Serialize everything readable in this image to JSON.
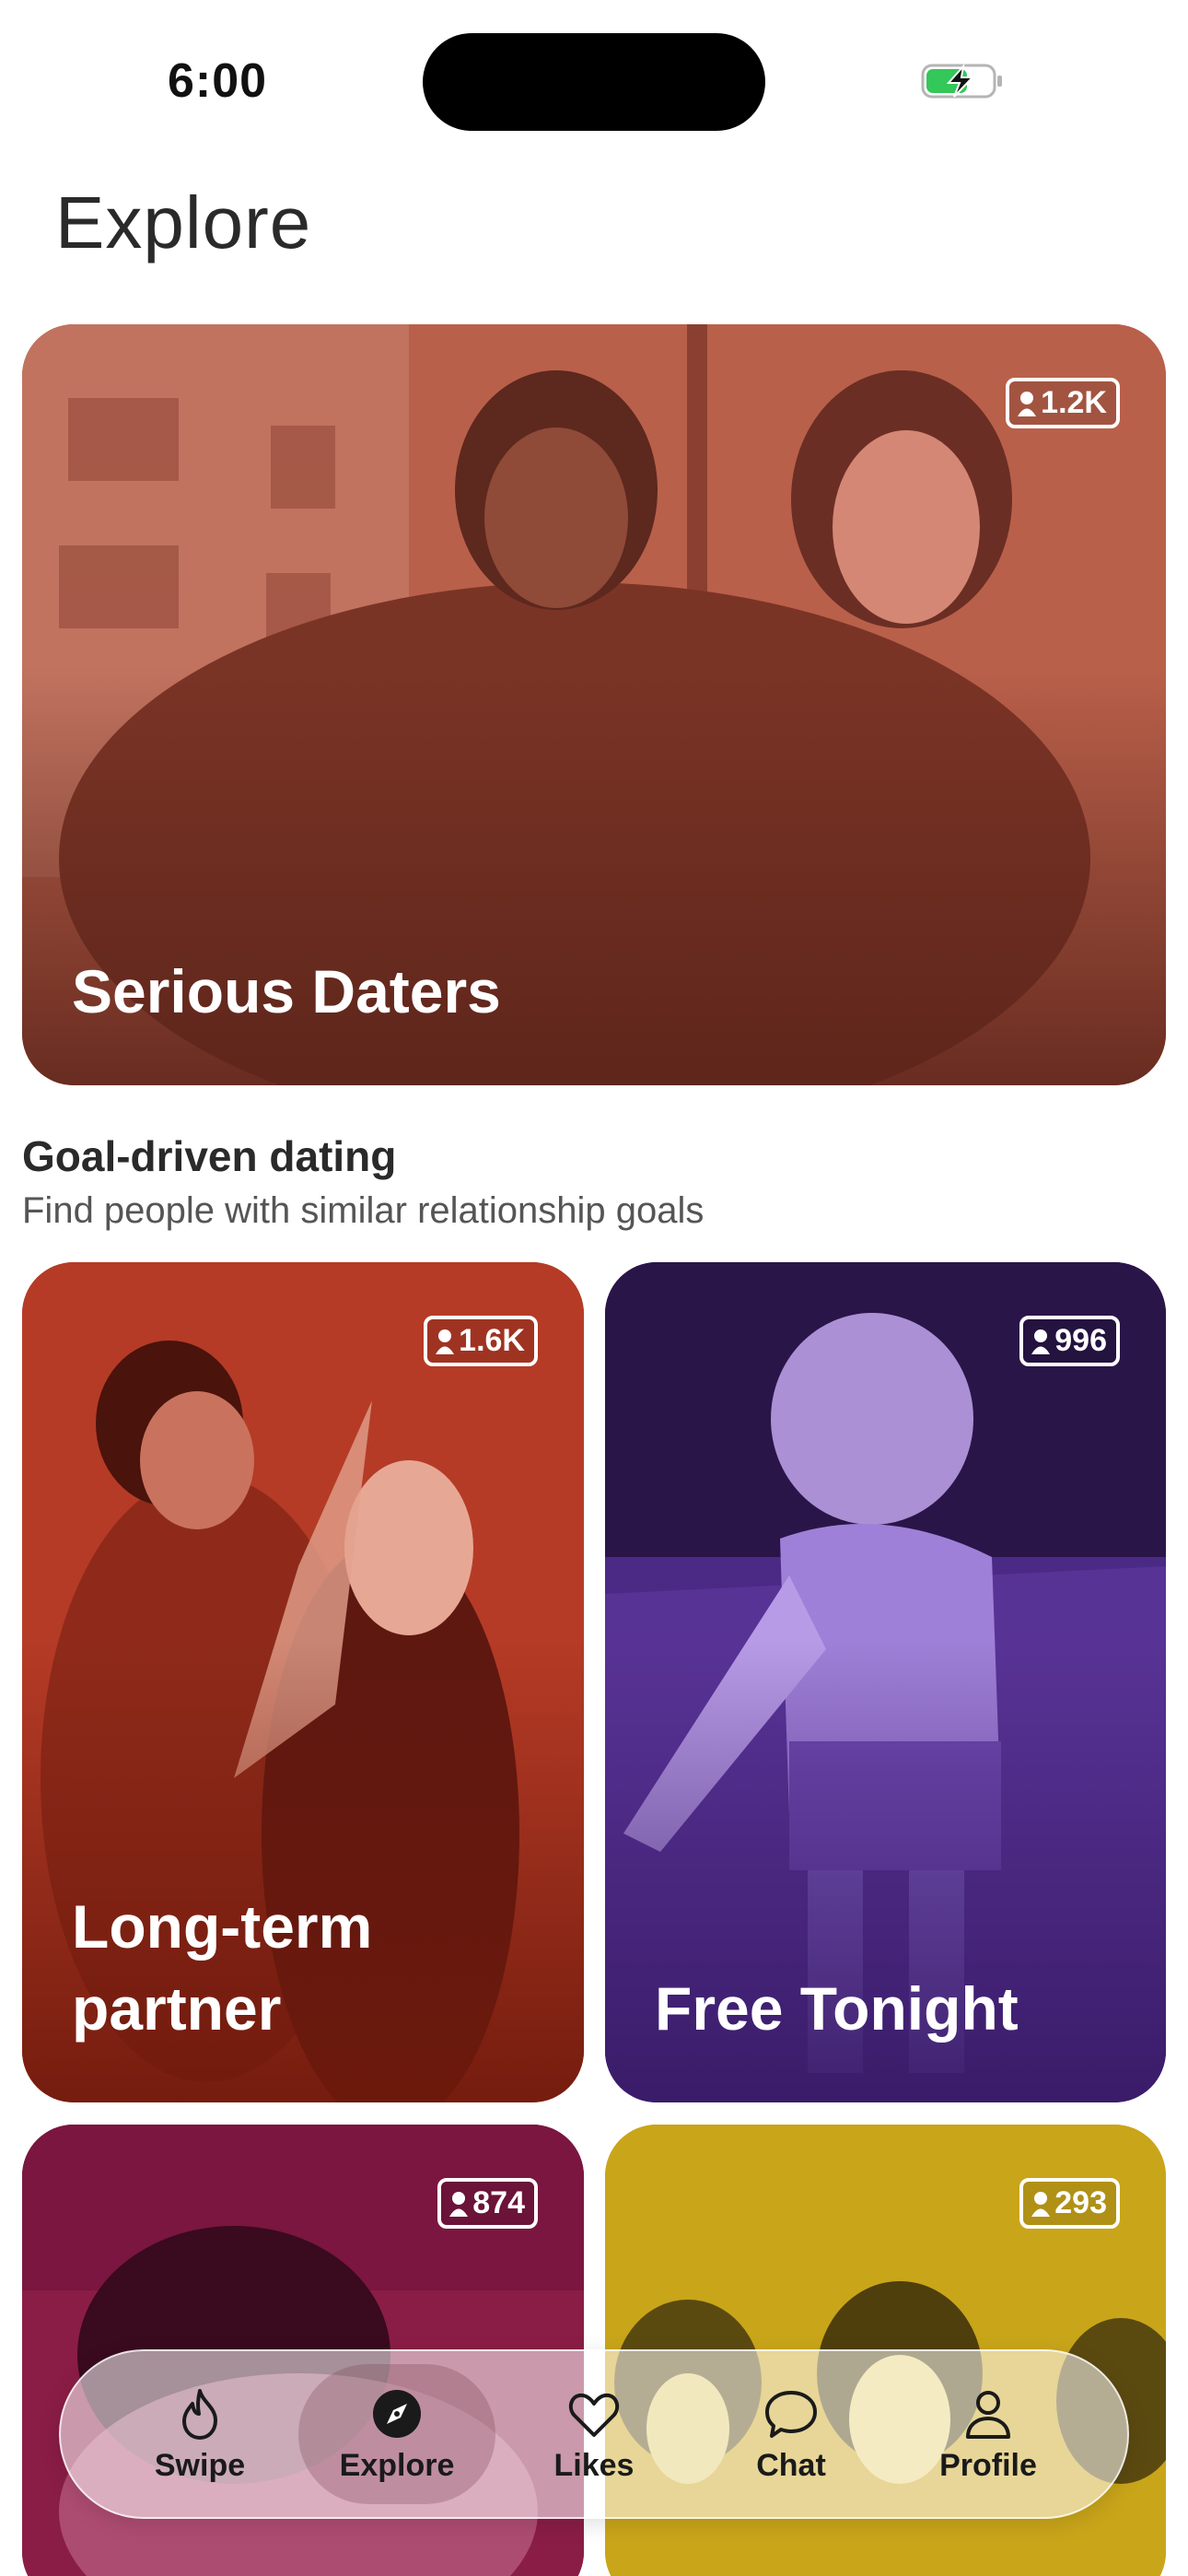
{
  "status_bar": {
    "time": "6:00",
    "battery_color": "#34c759"
  },
  "page_title": "Explore",
  "featured": {
    "title": "Serious Daters",
    "count": "1.2K",
    "tint": "#a35240"
  },
  "section": {
    "title": "Goal-driven dating",
    "subtitle": "Find people with similar relationship goals"
  },
  "cards": [
    {
      "title": "Long-term partner",
      "title_line1": "Long-term",
      "title_line2": "partner",
      "count": "1.6K",
      "tint": "#a83120"
    },
    {
      "title": "Free Tonight",
      "count": "996",
      "tint": "#4a2a85"
    },
    {
      "title": "",
      "count": "874",
      "tint": "#8a1d45"
    },
    {
      "title": "",
      "count": "293",
      "tint": "#c9a51a"
    }
  ],
  "tabbar": {
    "items": [
      {
        "label": "Swipe",
        "icon": "flame-icon",
        "active": false
      },
      {
        "label": "Explore",
        "icon": "compass-icon",
        "active": true
      },
      {
        "label": "Likes",
        "icon": "heart-icon",
        "active": false
      },
      {
        "label": "Chat",
        "icon": "chat-bubble-icon",
        "active": false
      },
      {
        "label": "Profile",
        "icon": "person-icon",
        "active": false
      }
    ]
  }
}
